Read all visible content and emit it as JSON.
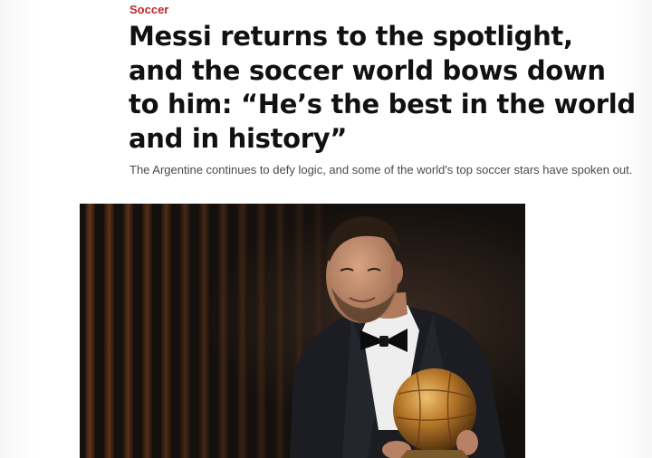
{
  "article": {
    "section": "Soccer",
    "headline": "Messi returns to the spotlight, and the soccer world bows down to him: “He’s the best in the world and in history”",
    "dek": "The Argentine continues to defy logic, and some of the world's top soccer stars have spoken out."
  },
  "hero_image": {
    "colors": {
      "background": "#1a120c",
      "stripe": "#5a2f17",
      "suit": "#1b1d22",
      "shirt": "#eeeeee",
      "skin": "#c58f70",
      "trophy": "#b8782a"
    }
  }
}
